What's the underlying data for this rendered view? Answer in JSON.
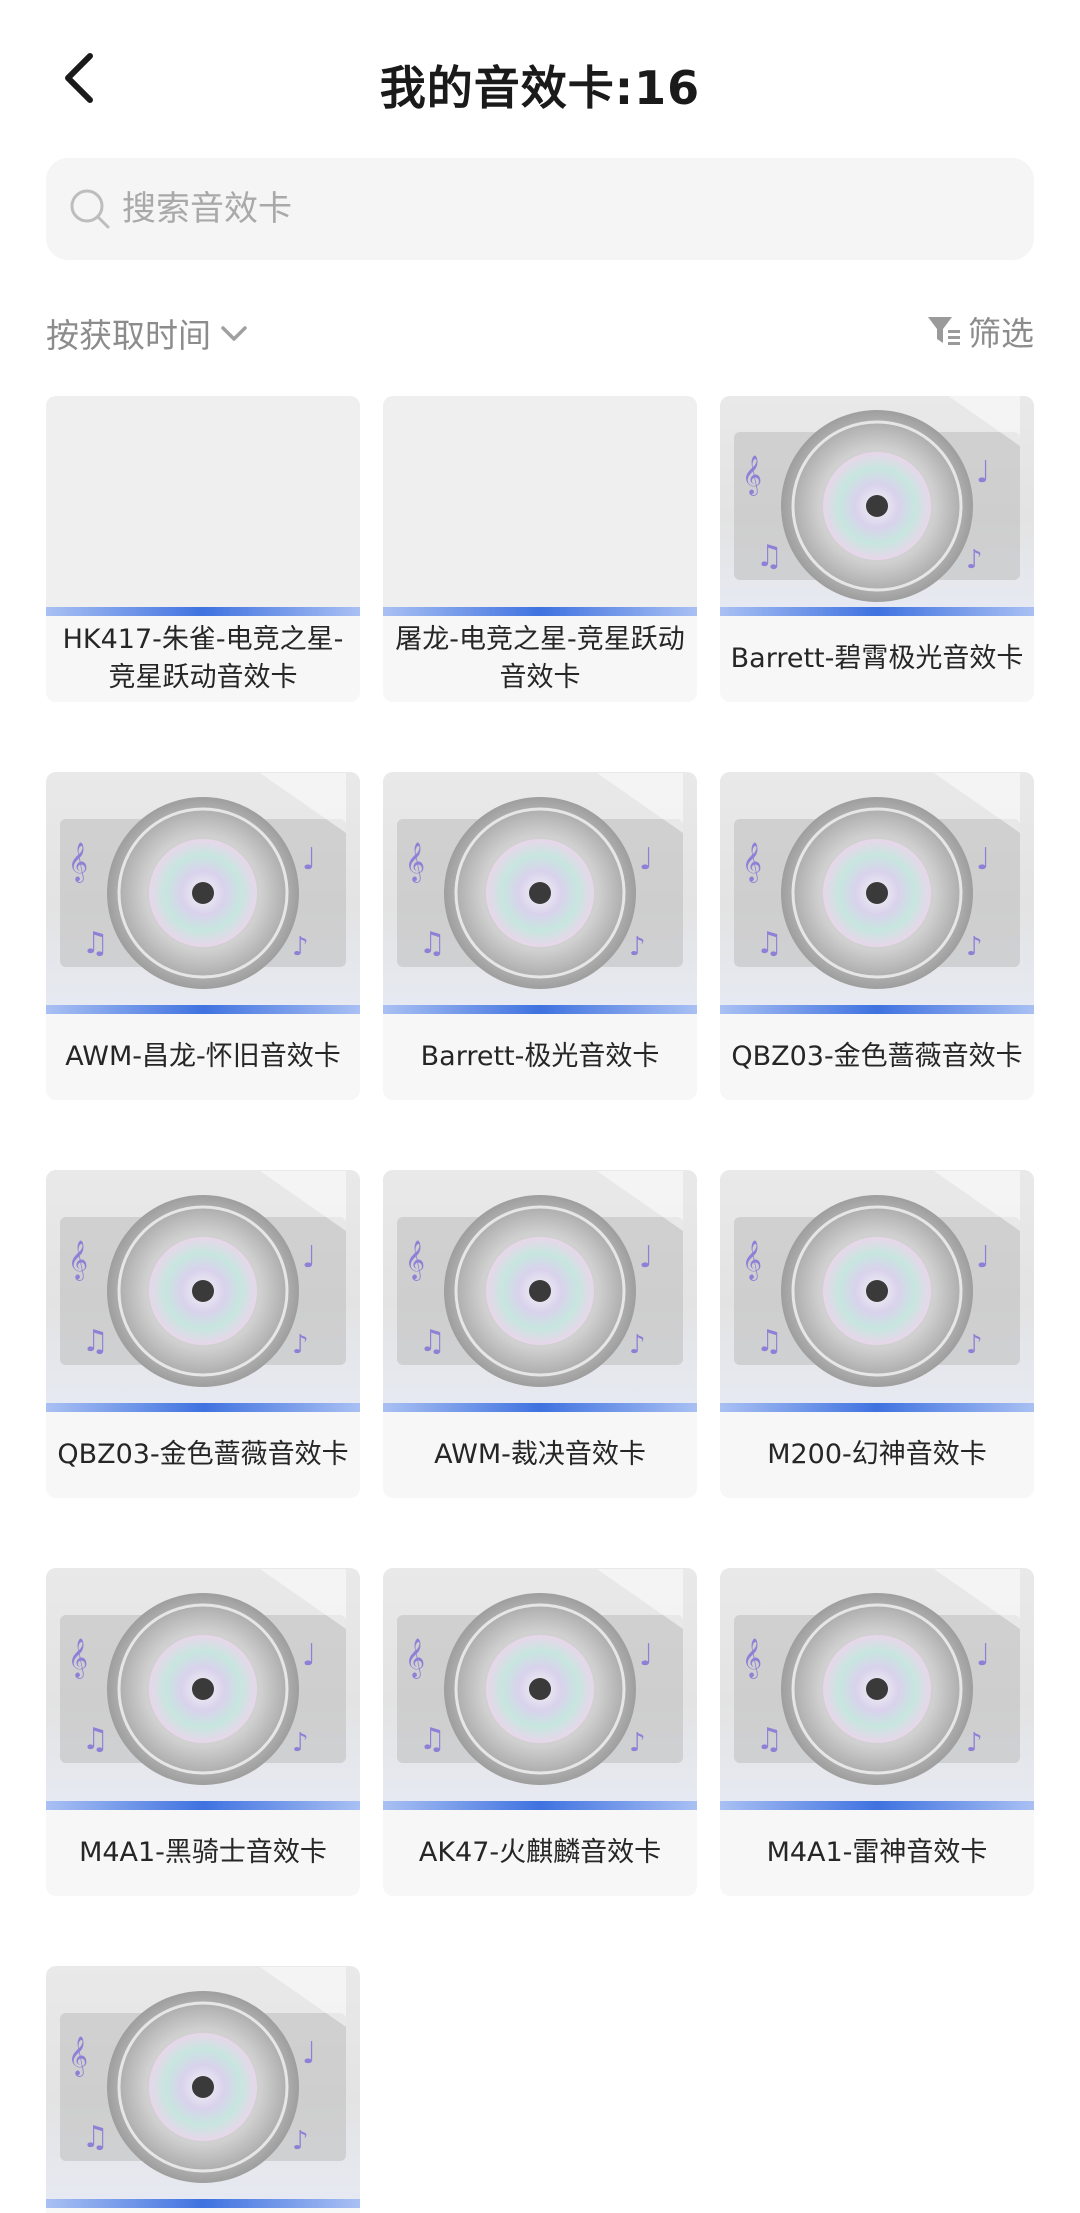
{
  "header": {
    "title": "我的音效卡:16"
  },
  "search": {
    "placeholder": "搜索音效卡"
  },
  "toolbar": {
    "sort_label": "按获取时间",
    "filter_label": "筛选"
  },
  "colors": {
    "accent_bar": "#3f72e0",
    "disc": "#c9c9c9",
    "note": "#8f7fd6"
  },
  "cards": [
    {
      "name": "HK417-朱雀-电竞之星-竞星跃动音效卡",
      "image": "blank"
    },
    {
      "name": "屠龙-电竞之星-竞星跃动音效卡",
      "image": "blank"
    },
    {
      "name": "Barrett-碧霄极光音效卡",
      "image": "disc"
    },
    {
      "name": "AWM-昌龙-怀旧音效卡",
      "image": "disc"
    },
    {
      "name": "Barrett-极光音效卡",
      "image": "disc"
    },
    {
      "name": "QBZ03-金色蔷薇音效卡",
      "image": "disc"
    },
    {
      "name": "QBZ03-金色蔷薇音效卡",
      "image": "disc"
    },
    {
      "name": "AWM-裁决音效卡",
      "image": "disc"
    },
    {
      "name": "M200-幻神音效卡",
      "image": "disc"
    },
    {
      "name": "M4A1-黑骑士音效卡",
      "image": "disc"
    },
    {
      "name": "AK47-火麒麟音效卡",
      "image": "disc"
    },
    {
      "name": "M4A1-雷神音效卡",
      "image": "disc"
    },
    {
      "name": "",
      "image": "disc"
    }
  ]
}
